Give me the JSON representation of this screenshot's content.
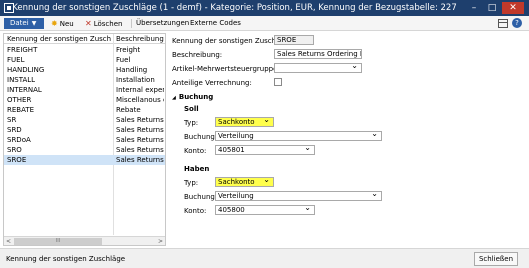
{
  "window": {
    "title": "Kennung der sonstigen Zuschläge (1 - demf) - Kategorie: Position, EUR, Kennung der Bezugstabelle: 227",
    "min_glyph": "–",
    "max_glyph": "□",
    "close_glyph": "✕"
  },
  "toolbar": {
    "datei": "Datei",
    "neu": "Neu",
    "loeschen": "Löschen",
    "uebersetzungen": "Übersetzungen",
    "externe_codes": "Externe Codes",
    "help_glyph": "?"
  },
  "grid": {
    "headers": [
      "Kennung der sonstigen Zuschläge",
      "Beschreibung"
    ],
    "rows": [
      {
        "code": "FREIGHT",
        "desc": "Freight"
      },
      {
        "code": "FUEL",
        "desc": "Fuel"
      },
      {
        "code": "HANDLING",
        "desc": "Handling"
      },
      {
        "code": "INSTALL",
        "desc": "Installation"
      },
      {
        "code": "INTERNAL",
        "desc": "Internal expense"
      },
      {
        "code": "OTHER",
        "desc": "Miscellanous char"
      },
      {
        "code": "REBATE",
        "desc": "Rebate"
      },
      {
        "code": "SR",
        "desc": "Sales Returns Obs"
      },
      {
        "code": "SRD",
        "desc": "Sales Returns Defe"
      },
      {
        "code": "SRDoA",
        "desc": "Sales Returns Dea"
      },
      {
        "code": "SRO",
        "desc": "Sales Returns Obs"
      },
      {
        "code": "SROE",
        "desc": "Sales Returns Orde"
      }
    ],
    "selected_index": 11,
    "scroll_left": "<",
    "scroll_right": ">",
    "scroll_grip": "III"
  },
  "detail": {
    "kennung_label": "Kennung der sonstigen Zuschläge:",
    "kennung_value": "SROE",
    "beschreibung_label": "Beschreibung:",
    "beschreibung_value": "Sales Returns Ordering Error",
    "artikel_label": "Artikel-Mehrwertsteuergruppe:",
    "artikel_value": "",
    "anteilige_label": "Anteilige Verrechnung:",
    "buchung_group": "Buchung",
    "soll": {
      "title": "Soll",
      "typ_label": "Typ:",
      "typ_value": "Sachkonto",
      "buchung_label": "Buchung:",
      "buchung_value": "Verteilung",
      "konto_label": "Konto:",
      "konto_value": "405801"
    },
    "haben": {
      "title": "Haben",
      "typ_label": "Typ:",
      "typ_value": "Sachkonto",
      "buchung_label": "Buchung:",
      "buchung_value": "Verteilung",
      "konto_label": "Konto:",
      "konto_value": "405800"
    }
  },
  "status": {
    "text": "Kennung der sonstigen Zuschläge",
    "close_button": "Schließen"
  },
  "colors": {
    "titlebar": "#1e3f6d",
    "selected_row": "#cfe3f7",
    "highlight_field": "#ffff4d"
  }
}
